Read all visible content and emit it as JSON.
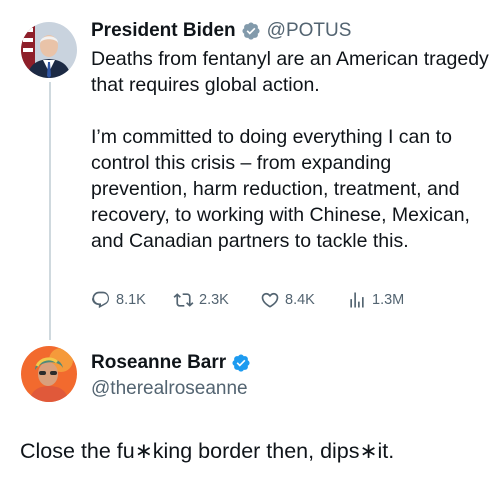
{
  "post1": {
    "author_name": "President Biden",
    "author_handle": "@POTUS",
    "paragraphs": [
      "Deaths from fentanyl are an American tragedy that requires global action.",
      "I’m committed to doing everything I can to control this crisis – from expanding prevention, harm reduction, treatment, and recovery, to working with Chinese, Mexican, and Canadian partners to tackle this."
    ],
    "stats": {
      "replies": "8.1K",
      "reposts": "2.3K",
      "likes": "8.4K",
      "views": "1.3M"
    }
  },
  "post2": {
    "author_name": "Roseanne Barr",
    "author_handle": "@therealroseanne",
    "text": "Close the fu∗king border then, dips∗it."
  },
  "colors": {
    "text": "#0f1419",
    "secondary_text": "#536471",
    "verified_blue": "#1d9bf0",
    "verified_gray": "#829aab",
    "thread_line": "#cfd9de"
  },
  "icons": {
    "reply": "reply-icon",
    "repost": "repost-icon",
    "like": "like-icon",
    "views": "views-icon",
    "verified_gov": "verified-gray-badge-icon",
    "verified": "verified-blue-badge-icon"
  }
}
